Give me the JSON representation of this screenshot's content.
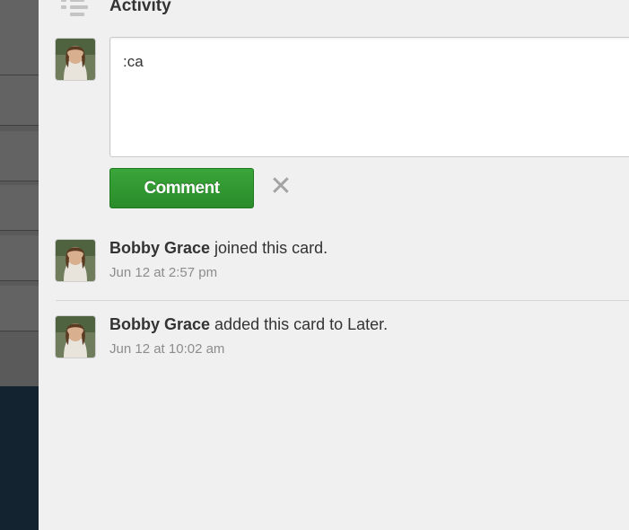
{
  "activity": {
    "title": "Activity",
    "icon": "activity-list-icon"
  },
  "comment": {
    "current_user_avatar": "avatar",
    "input_value": ":ca",
    "submit_label": "Comment",
    "cancel_icon": "close-icon"
  },
  "entries": [
    {
      "member": "Bobby Grace",
      "action": " joined this card.",
      "date": "Jun 12 at 2:57 pm"
    },
    {
      "member": "Bobby Grace",
      "action": " added this card to Later.",
      "date": "Jun 12 at 10:02 am"
    }
  ],
  "colors": {
    "button_green": "#2f9a2f",
    "panel_background": "#f0f0f0",
    "board_background": "#13232f"
  }
}
